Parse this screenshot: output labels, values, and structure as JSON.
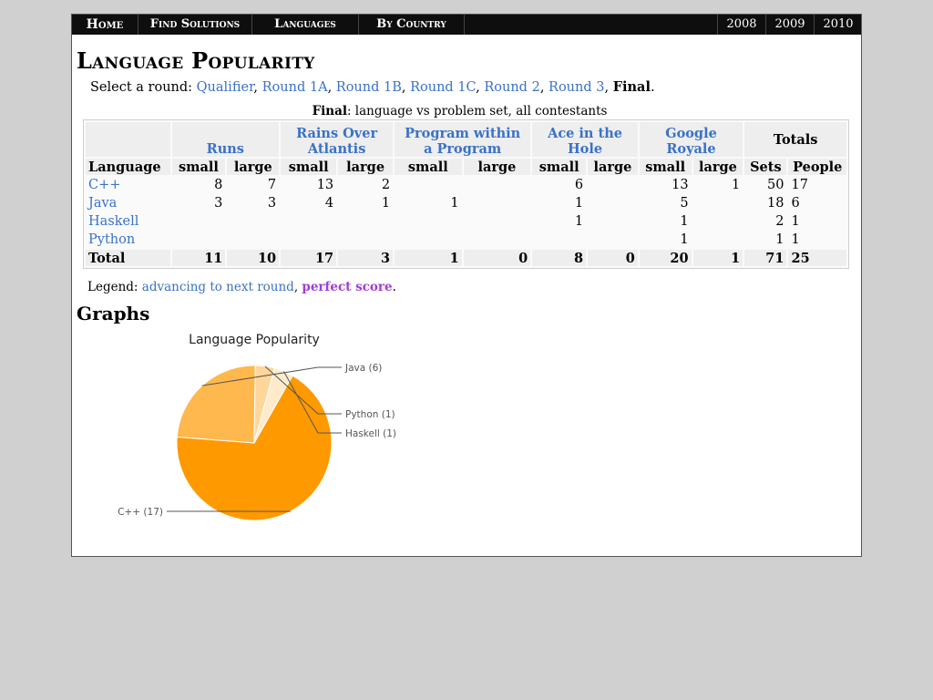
{
  "nav": {
    "items": [
      "Home",
      "Find Solutions",
      "Languages",
      "By Country"
    ],
    "years": [
      "2008",
      "2009",
      "2010"
    ]
  },
  "title": "Language Popularity",
  "round_select": {
    "prefix": "Select a round: ",
    "rounds": [
      "Qualifier",
      "Round 1A",
      "Round 1B",
      "Round 1C",
      "Round 2",
      "Round 3"
    ],
    "current": "Final"
  },
  "caption": {
    "bold": "Final",
    "rest": ": language vs problem set, all contestants"
  },
  "table": {
    "problems": [
      "Runs",
      "Rains Over Atlantis",
      "Program within a Program",
      "Ace in the Hole",
      "Google Royale"
    ],
    "problem_lines": [
      [
        "Runs"
      ],
      [
        "Rains Over",
        "Atlantis"
      ],
      [
        "Program within",
        "a Program"
      ],
      [
        "Ace in the",
        "Hole"
      ],
      [
        "Google",
        "Royale"
      ]
    ],
    "totals_header": "Totals",
    "language_header": "Language",
    "small": "small",
    "large": "large",
    "sets": "Sets",
    "people": "People",
    "rows": [
      {
        "language": "C++",
        "cells": [
          "8",
          "7",
          "13",
          "2",
          "",
          "",
          "6",
          "",
          "13",
          "1"
        ],
        "sets": "50",
        "people": "17"
      },
      {
        "language": "Java",
        "cells": [
          "3",
          "3",
          "4",
          "1",
          "1",
          "",
          "1",
          "",
          "5",
          ""
        ],
        "sets": "18",
        "people": "6"
      },
      {
        "language": "Haskell",
        "cells": [
          "",
          "",
          "",
          "",
          "",
          "",
          "1",
          "",
          "1",
          ""
        ],
        "sets": "2",
        "people": "1"
      },
      {
        "language": "Python",
        "cells": [
          "",
          "",
          "",
          "",
          "",
          "",
          "",
          "",
          "1",
          ""
        ],
        "sets": "1",
        "people": "1"
      }
    ],
    "total": {
      "label": "Total",
      "cells": [
        "11",
        "10",
        "17",
        "3",
        "1",
        "0",
        "8",
        "0",
        "20",
        "1"
      ],
      "sets": "71",
      "people": "25"
    }
  },
  "legend": {
    "prefix": "Legend: ",
    "advancing": "advancing to next round",
    "sep": ", ",
    "perfect": "perfect score",
    "end": "."
  },
  "graphs_title": "Graphs",
  "chart_data": {
    "type": "pie",
    "title": "Language Popularity",
    "categories": [
      "C++",
      "Java",
      "Python",
      "Haskell"
    ],
    "values": [
      17,
      6,
      1,
      1
    ],
    "labels": [
      "C++ (17)",
      "Java (6)",
      "Python (1)",
      "Haskell (1)"
    ],
    "colors": [
      "#ff9900",
      "#ffb84d",
      "#ffd699",
      "#ffebcc"
    ]
  },
  "colors": {
    "link": "#3a72c8",
    "perfect": "#a23bd6",
    "nav_bg": "#0e0e0e"
  }
}
